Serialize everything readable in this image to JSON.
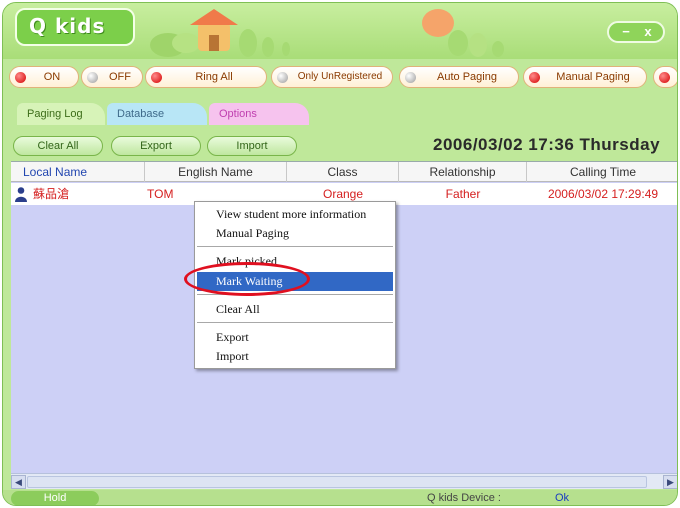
{
  "app": {
    "title": "Q kids",
    "minimize_symbol": "−",
    "close_symbol": "x"
  },
  "controls": [
    {
      "label": "ON",
      "dot": "red"
    },
    {
      "label": "OFF",
      "dot": "grey"
    },
    {
      "label": "Ring All",
      "dot": "red"
    },
    {
      "label": "Only UnRegistered",
      "dot": "grey"
    },
    {
      "label": "Auto Paging",
      "dot": "grey"
    },
    {
      "label": "Manual Paging",
      "dot": "red"
    }
  ],
  "tabs": [
    "Paging Log",
    "Database",
    "Options"
  ],
  "actions": [
    "Clear All",
    "Export",
    "Import"
  ],
  "datetime": "2006/03/02  17:36  Thursday",
  "table": {
    "columns": [
      "Local Name",
      "English Name",
      "Class",
      "Relationship",
      "Calling Time"
    ],
    "rows": [
      {
        "local_name": "蘇品滄",
        "english_name": "TOM",
        "class": "Orange",
        "relationship": "Father",
        "calling_time": "2006/03/02 17:29:49"
      }
    ]
  },
  "status": {
    "hold": "Hold",
    "device_label": "Q kids Device :",
    "device_value": "Ok"
  },
  "context_menu": {
    "items": [
      "View student more information",
      "Manual Paging",
      "Mark picked",
      "Mark Waiting",
      "Clear All",
      "Export",
      "Import"
    ],
    "highlighted": "Mark Waiting"
  },
  "colors": {
    "accent_green": "#7ccf4a",
    "highlight_blue": "#3168c5",
    "row_text_red": "#d52020",
    "callout_red": "#e01020"
  },
  "icons": {
    "person": "person-icon",
    "scroll_left": "scroll-left-icon",
    "scroll_right": "scroll-right-icon"
  }
}
